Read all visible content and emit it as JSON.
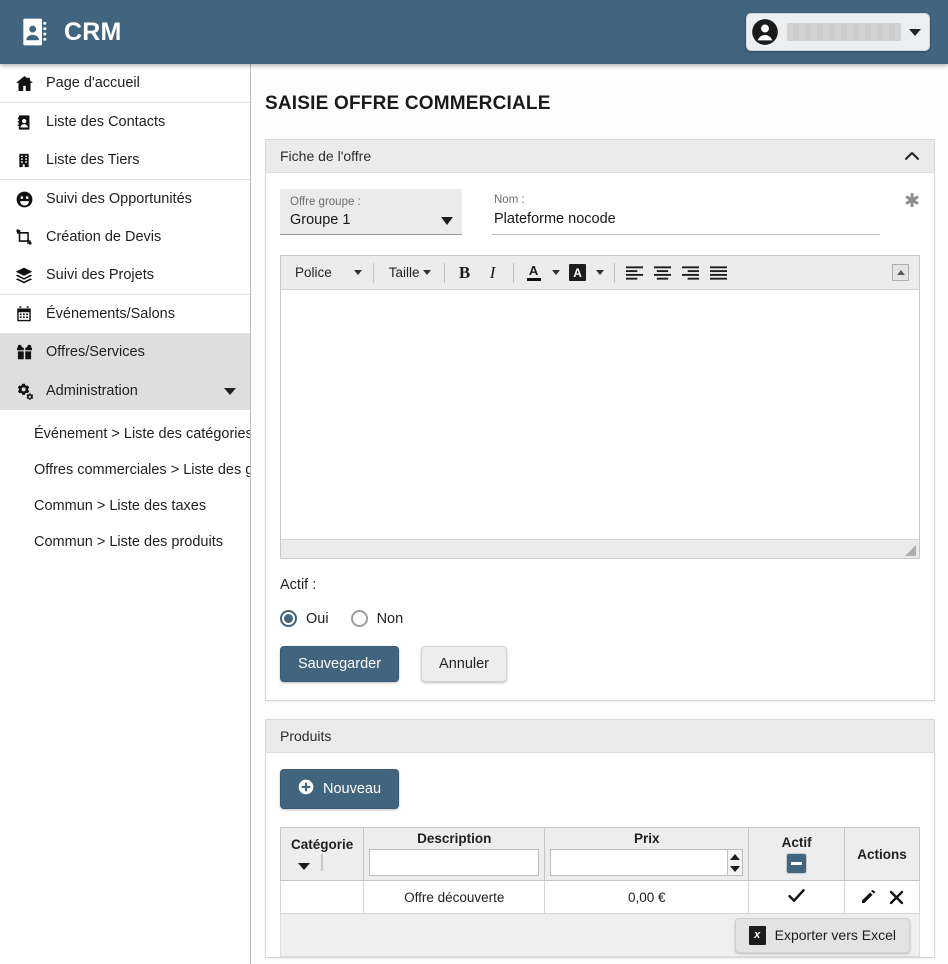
{
  "app": {
    "brand_title": "CRM",
    "brand_icon": "contact-book-icon",
    "user_name": "",
    "user_avatar_icon": "user-circle-icon"
  },
  "sidebar": {
    "groups": [
      {
        "items": [
          {
            "label": "Page d'accueil",
            "icon": "home-icon",
            "active": false
          }
        ]
      },
      {
        "items": [
          {
            "label": "Liste des Contacts",
            "icon": "address-book-icon",
            "active": false
          },
          {
            "label": "Liste des Tiers",
            "icon": "building-icon",
            "active": false
          }
        ]
      },
      {
        "items": [
          {
            "label": "Suivi des Opportunités",
            "icon": "smiley-icon",
            "active": false
          },
          {
            "label": "Création de Devis",
            "icon": "crop-icon",
            "active": false
          },
          {
            "label": "Suivi des Projets",
            "icon": "layers-icon",
            "active": false
          }
        ]
      },
      {
        "items": [
          {
            "label": "Événements/Salons",
            "icon": "calendar-icon",
            "active": false
          },
          {
            "label": "Offres/Services",
            "icon": "gift-icon",
            "active": true
          }
        ]
      },
      {
        "items": [
          {
            "label": "Administration",
            "icon": "gears-icon",
            "active": true,
            "expanded": true
          }
        ]
      }
    ],
    "admin_submenu": [
      "Événement > Liste des catégories",
      "Offres commerciales > Liste des groupes",
      "Commun > Liste des taxes",
      "Commun > Liste des produits"
    ]
  },
  "main": {
    "page_title": "SAISIE OFFRE COMMERCIALE",
    "offer_card": {
      "header": "Fiche de l'offre",
      "collapse_icon": "chevron-up-icon",
      "group_field": {
        "label": "Offre groupe :",
        "value": "Groupe 1"
      },
      "name_field": {
        "label": "Nom :",
        "value": "Plateforme nocode",
        "placeholder": ""
      },
      "required_marker": "✱",
      "editor": {
        "font_label": "Police",
        "size_label": "Taille",
        "bold_label": "B",
        "italic_label": "I",
        "text_color_label": "A",
        "highlight_label": "A",
        "content": "",
        "placeholder": ""
      },
      "actif_label": "Actif :",
      "radio_yes": "Oui",
      "radio_no": "Non",
      "radio_selected": "Oui",
      "save_label": "Sauvegarder",
      "cancel_label": "Annuler"
    },
    "products_card": {
      "header": "Produits",
      "new_label": "Nouveau",
      "columns": [
        "Catégorie",
        "Description",
        "Prix",
        "Actif",
        "Actions"
      ],
      "filters": {
        "categorie_value": "",
        "description_value": "",
        "description_placeholder": "",
        "prix_value": "",
        "prix_placeholder": "",
        "actif_state": "indeterminate"
      },
      "rows": [
        {
          "categorie": "",
          "description": "Offre découverte",
          "prix": "0,00 €",
          "actif": "✔",
          "edit_icon": "pencil-icon",
          "delete_icon": "close-x-icon"
        }
      ],
      "export_label": "Exporter vers Excel",
      "export_icon": "excel-file-icon"
    }
  },
  "colors": {
    "brand_blue": "#41647F",
    "active_nav": "#dedede",
    "panel_header": "#ebebeb",
    "page_bg": "#fdfdfd"
  }
}
